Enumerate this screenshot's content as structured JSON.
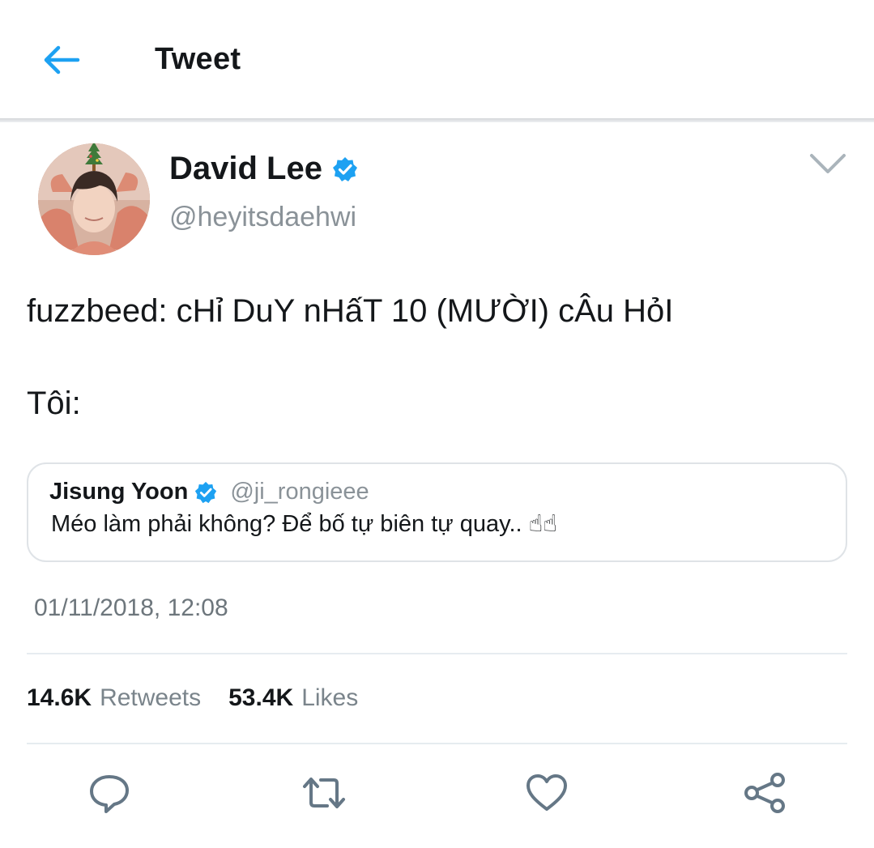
{
  "header": {
    "title": "Tweet",
    "back_icon": "arrow-left-icon",
    "accent_color": "#1da1f2"
  },
  "author": {
    "display_name": "David Lee",
    "handle": "@heyitsdaehwi",
    "verified_icon": "verified-badge-icon"
  },
  "tweet": {
    "line1": "fuzzbeed: cHỉ DuY nHấT 10 (MƯỜI) cÂu HỏI",
    "line2": "Tôi:"
  },
  "quoted_tweet": {
    "display_name": "Jisung Yoon",
    "handle": "@ji_rongieee",
    "text": "Méo làm phải không? Để bố tự biên tự quay.. ☝☝"
  },
  "timestamp": "01/11/2018, 12:08",
  "stats": {
    "retweets_count": "14.6K",
    "retweets_label": "Retweets",
    "likes_count": "53.4K",
    "likes_label": "Likes"
  },
  "actions": [
    "reply-icon",
    "retweet-icon",
    "like-icon",
    "share-icon"
  ]
}
